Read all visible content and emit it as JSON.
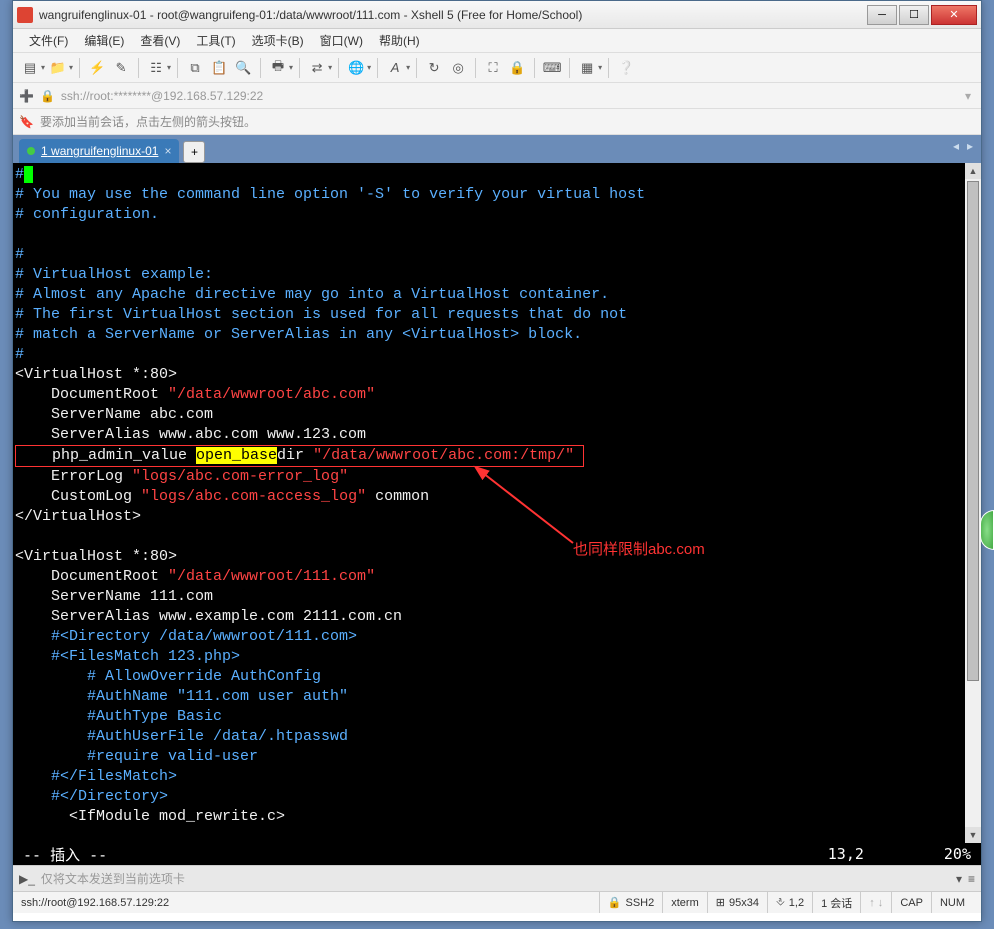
{
  "window": {
    "title": "wangruifenglinux-01 - root@wangruifeng-01:/data/wwwroot/111.com - Xshell 5 (Free for Home/School)"
  },
  "menu": {
    "file": "文件(F)",
    "edit": "编辑(E)",
    "view": "查看(V)",
    "tools": "工具(T)",
    "tabs": "选项卡(B)",
    "window": "窗口(W)",
    "help": "帮助(H)"
  },
  "address": {
    "url": "ssh://root:********@192.168.57.129:22"
  },
  "hint": {
    "text": "要添加当前会话，点击左侧的箭头按钮。"
  },
  "tab": {
    "index": "1",
    "label": "wangruifenglinux-01"
  },
  "terminal": {
    "l1": "#",
    "l2": "# You may use the command line option '-S' to verify your virtual host",
    "l3": "# configuration.",
    "l4": "#",
    "l5": "# VirtualHost example:",
    "l6": "# Almost any Apache directive may go into a VirtualHost container.",
    "l7": "# The first VirtualHost section is used for all requests that do not",
    "l8": "# match a ServerName or ServerAlias in any <VirtualHost> block.",
    "l9": "#",
    "vhost1_open": "<VirtualHost *:80>",
    "docroot1_k": "    DocumentRoot ",
    "docroot1_v": "\"/data/wwwroot/abc.com\"",
    "servername1": "    ServerName abc.com",
    "serveralias1": "    ServerAlias www.abc.com www.123.com",
    "phpval_pre": "    php_admin_value ",
    "phpval_hl": "open_base",
    "phpval_post": "dir ",
    "phpval_path": "\"/data/wwwroot/abc.com:/tmp/\"",
    "errlog_k": "    ErrorLog ",
    "errlog_v": "\"logs/abc.com-error_log\"",
    "custlog_k": "    CustomLog ",
    "custlog_v": "\"logs/abc.com-access_log\"",
    "custlog_e": " common",
    "vhost1_close": "</VirtualHost>",
    "vhost2_open": "<VirtualHost *:80>",
    "docroot2_k": "    DocumentRoot ",
    "docroot2_v": "\"/data/wwwroot/111.com\"",
    "servername2": "    ServerName 111.com",
    "serveralias2": "    ServerAlias www.example.com 2111.com.cn",
    "dir_open": "    #<Directory /data/wwwroot/111.com>",
    "fm_open": "    #<FilesMatch 123.php>",
    "allowoverride": "        # AllowOverride AuthConfig",
    "authname": "        #AuthName \"111.com user auth\"",
    "authtype": "        #AuthType Basic",
    "authuserfile": "        #AuthUserFile /data/.htpasswd",
    "require": "        #require valid-user",
    "fm_close": "    #</FilesMatch>",
    "dir_close": "    #</Directory>",
    "ifmodule": "      <IfModule mod_rewrite.c>",
    "mode": "-- 插入 --",
    "pos": "13,2",
    "pct": "20%"
  },
  "annotation": {
    "text": "也同样限制abc.com"
  },
  "bottom": {
    "msg": "仅将文本发送到当前选项卡"
  },
  "status": {
    "conn": "ssh://root@192.168.57.129:22",
    "proto": "SSH2",
    "term": "xterm",
    "size": "95x34",
    "pos": "1,2",
    "sessions": "1 会话",
    "cap": "CAP",
    "num": "NUM"
  }
}
